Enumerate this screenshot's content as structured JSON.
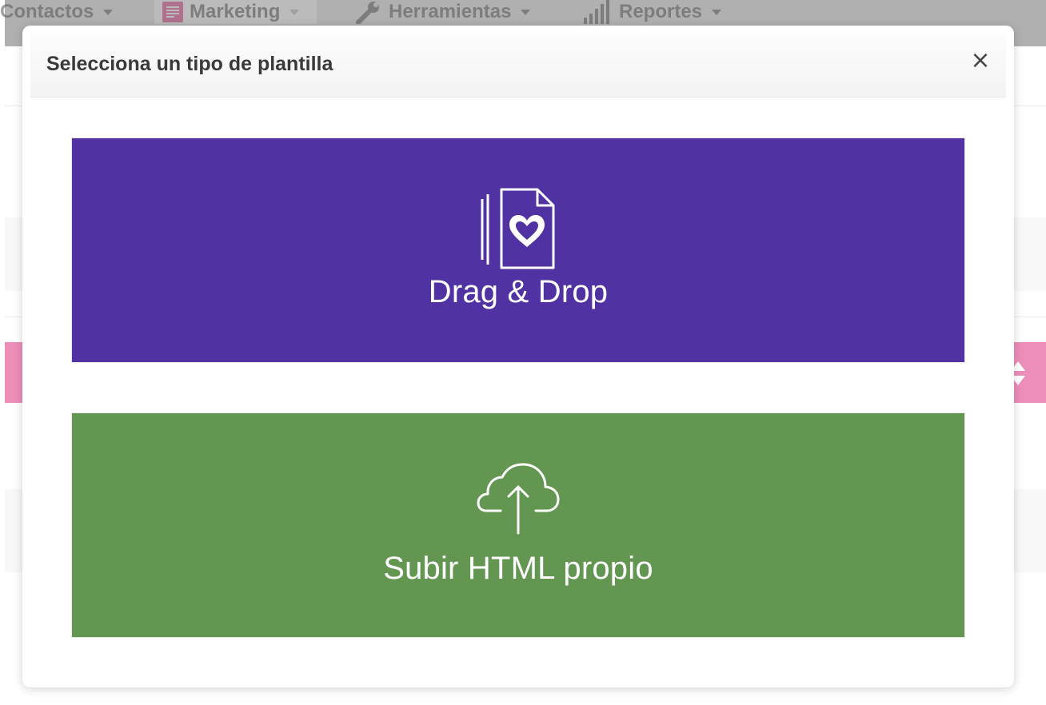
{
  "nav": {
    "items": [
      {
        "label": "Contactos"
      },
      {
        "label": "Marketing"
      },
      {
        "label": "Herramientas"
      },
      {
        "label": "Reportes"
      }
    ]
  },
  "modal": {
    "title": "Selecciona un tipo de plantilla",
    "close_label": "×",
    "options": [
      {
        "label": "Drag & Drop",
        "icon": "document-heart-icon",
        "color": "#5132a2"
      },
      {
        "label": "Subir HTML propio",
        "icon": "cloud-upload-icon",
        "color": "#629651"
      }
    ]
  },
  "colors": {
    "nav_accent": "#e24a8f",
    "nav_text": "#666666"
  }
}
